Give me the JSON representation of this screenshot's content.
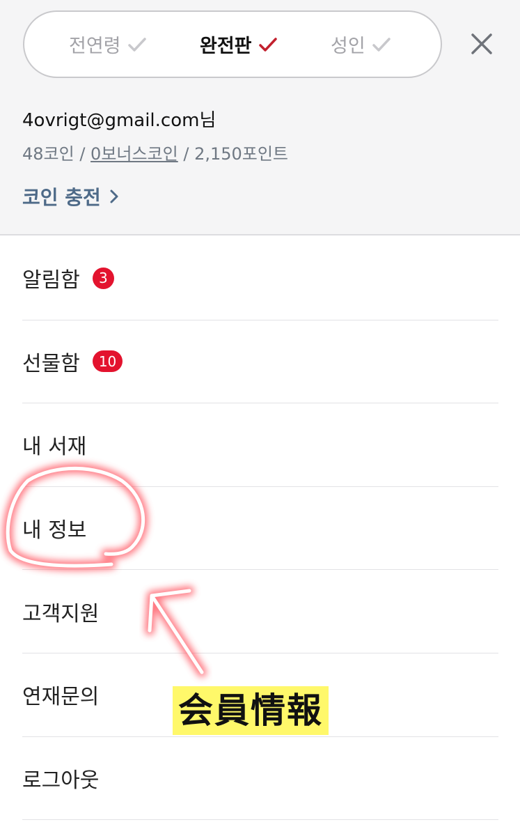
{
  "segments": [
    {
      "label": "전연령",
      "active": false
    },
    {
      "label": "완전판",
      "active": true
    },
    {
      "label": "성인",
      "active": false
    }
  ],
  "account": {
    "email": "4ovrigt@gmail.com님",
    "coins": "48코인",
    "sep1": " / ",
    "bonus": "0보너스코인",
    "sep2": " / ",
    "points": "2,150포인트"
  },
  "charge": {
    "label": "코인 충전"
  },
  "menu": [
    {
      "label": "알림함",
      "badge": "3"
    },
    {
      "label": "선물함",
      "badge": "10"
    },
    {
      "label": "내 서재"
    },
    {
      "label": "내 정보"
    },
    {
      "label": "고객지원"
    },
    {
      "label": "연재문의"
    },
    {
      "label": "로그아웃"
    }
  ],
  "annotation": {
    "caption": "会員情報"
  },
  "colors": {
    "accent": "#c2202e",
    "badge": "#e3132e",
    "charge": "#4e6a88",
    "highlight": "#fff86a"
  }
}
